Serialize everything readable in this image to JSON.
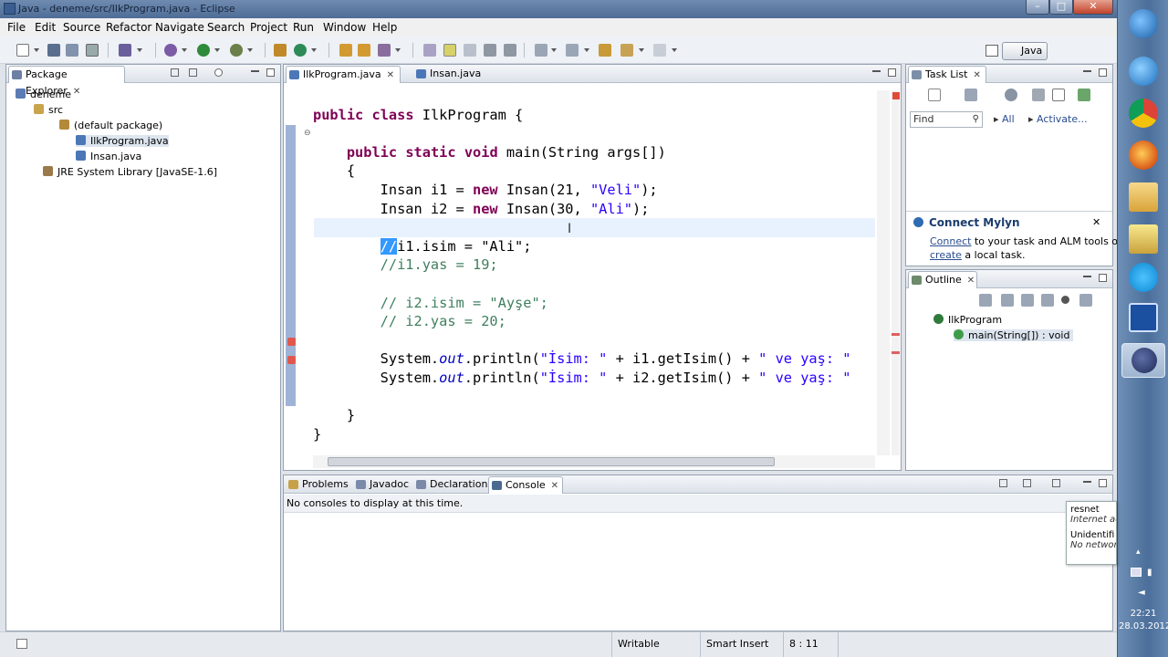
{
  "window": {
    "title": "Java - deneme/src/IlkProgram.java - Eclipse"
  },
  "menu": [
    "File",
    "Edit",
    "Source",
    "Refactor",
    "Navigate",
    "Search",
    "Project",
    "Run",
    "Window",
    "Help"
  ],
  "perspective": "Java",
  "package_explorer": {
    "tab": "Package Explorer",
    "tree": [
      "deneme",
      "src",
      "(default package)",
      "IlkProgram.java",
      "Insan.java",
      "JRE System Library [JavaSE-1.6]"
    ]
  },
  "editor": {
    "tabs": [
      "IlkProgram.java",
      "Insan.java"
    ],
    "active_tab": "IlkProgram.java"
  },
  "task_list": {
    "tab": "Task List",
    "find_placeholder": "Find",
    "all": "All",
    "activate": "Activate..."
  },
  "mylyn": {
    "title": "Connect Mylyn",
    "connect": "Connect",
    "line1_rest": " to your task and ALM tools or",
    "create": "create",
    "line2_rest": " a local task."
  },
  "outline": {
    "tab": "Outline",
    "items": [
      "IlkProgram",
      "main(String[]) : void"
    ]
  },
  "bottom": {
    "tabs": [
      "Problems",
      "Javadoc",
      "Declaration",
      "Console"
    ],
    "active_tab": "Console",
    "message": "No consoles to display at this time."
  },
  "status": {
    "writable": "Writable",
    "insert_mode": "Smart Insert",
    "position": "8 : 11"
  },
  "taskbar": {
    "time": "22:21",
    "date": "28.03.2012"
  },
  "network_popup": {
    "line1": "resnet",
    "line2": "Internet ac",
    "line3": "Unidentifi",
    "line4": "No networ"
  }
}
